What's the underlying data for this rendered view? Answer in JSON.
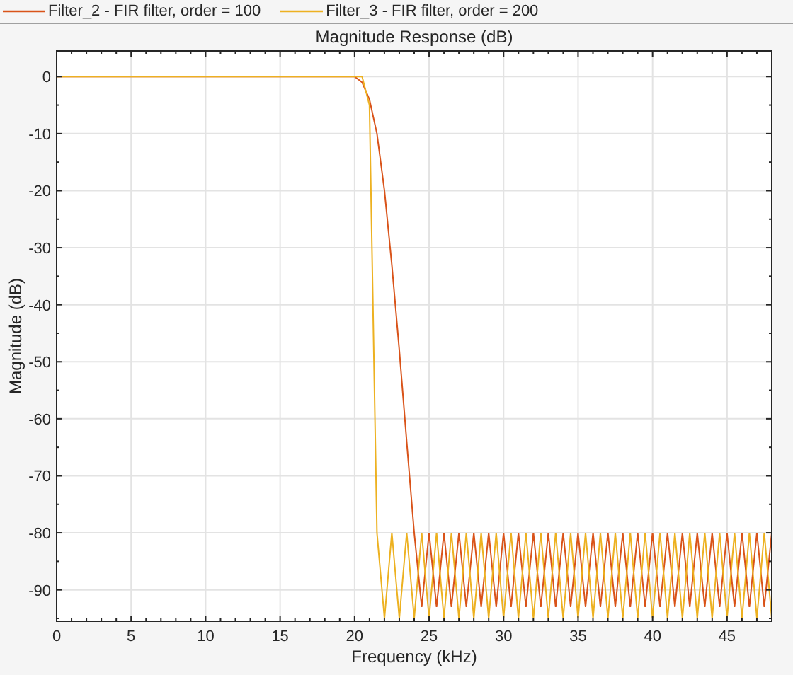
{
  "legend": {
    "kind": "legend"
  },
  "chart_data": {
    "type": "line",
    "title": "Magnitude Response (dB)",
    "xlabel": "Frequency (kHz)",
    "ylabel": "Magnitude (dB)",
    "x": [
      0,
      0.5,
      1,
      1.5,
      2,
      2.5,
      3,
      3.5,
      4,
      4.5,
      5,
      5.5,
      6,
      6.5,
      7,
      7.5,
      8,
      8.5,
      9,
      9.5,
      10,
      10.5,
      11,
      11.5,
      12,
      12.5,
      13,
      13.5,
      14,
      14.5,
      15,
      15.5,
      16,
      16.5,
      17,
      17.5,
      18,
      18.5,
      19,
      19.5,
      20,
      20.5,
      21,
      21.5,
      22,
      22.5,
      23,
      23.5,
      24,
      24.5,
      25,
      25.5,
      26,
      26.5,
      27,
      27.5,
      28,
      28.5,
      29,
      29.5,
      30,
      30.5,
      31,
      31.5,
      32,
      32.5,
      33,
      33.5,
      34,
      34.5,
      35,
      35.5,
      36,
      36.5,
      37,
      37.5,
      38,
      38.5,
      39,
      39.5,
      40,
      40.5,
      41,
      41.5,
      42,
      42.5,
      43,
      43.5,
      44,
      44.5,
      45,
      45.5,
      46,
      46.5,
      47,
      47.5,
      48
    ],
    "series": [
      {
        "name": "Filter_2 - FIR filter, order = 100",
        "color": "#d95319",
        "values": [
          0,
          0,
          0,
          0,
          0,
          0,
          0,
          0,
          0,
          0,
          0,
          0,
          0,
          0,
          0,
          0,
          0,
          0,
          0,
          0,
          0,
          0,
          0,
          0,
          0,
          0,
          0,
          0,
          0,
          0,
          0,
          0,
          0,
          0,
          0,
          0,
          0,
          0,
          0,
          0,
          0,
          -1,
          -4,
          -10,
          -20,
          -33,
          -48,
          -64,
          -80,
          -93,
          -80,
          -93,
          -80,
          -93,
          -80,
          -93,
          -80,
          -93,
          -80,
          -93,
          -80,
          -93,
          -80,
          -93,
          -80,
          -93,
          -80,
          -93,
          -80,
          -93,
          -80,
          -93,
          -80,
          -93,
          -80,
          -93,
          -80,
          -93,
          -80,
          -93,
          -80,
          -93,
          -80,
          -93,
          -80,
          -93,
          -80,
          -93,
          -80,
          -93,
          -80,
          -93,
          -80,
          -93,
          -80,
          -93,
          -80
        ]
      },
      {
        "name": "Filter_3 - FIR filter, order = 200",
        "color": "#edb120",
        "values": [
          0,
          0,
          0,
          0,
          0,
          0,
          0,
          0,
          0,
          0,
          0,
          0,
          0,
          0,
          0,
          0,
          0,
          0,
          0,
          0,
          0,
          0,
          0,
          0,
          0,
          0,
          0,
          0,
          0,
          0,
          0,
          0,
          0,
          0,
          0,
          0,
          0,
          0,
          0,
          0,
          0,
          0,
          -5,
          -80,
          -95,
          -80,
          -95,
          -80,
          -95,
          -80,
          -95,
          -80,
          -95,
          -80,
          -95,
          -80,
          -95,
          -80,
          -95,
          -80,
          -95,
          -80,
          -95,
          -80,
          -95,
          -80,
          -95,
          -80,
          -95,
          -80,
          -95,
          -80,
          -95,
          -80,
          -95,
          -80,
          -95,
          -80,
          -95,
          -80,
          -95,
          -80,
          -95,
          -80,
          -95,
          -80,
          -95,
          -80,
          -95,
          -80,
          -95,
          -80,
          -95,
          -80,
          -95,
          -80,
          -95
        ]
      }
    ],
    "grid": true,
    "xlim": [
      0,
      48
    ],
    "ylim": [
      -95.5,
      4.5
    ],
    "xticks": [
      0,
      5,
      10,
      15,
      20,
      25,
      30,
      35,
      40,
      45
    ],
    "yticks": [
      0,
      -10,
      -20,
      -30,
      -40,
      -50,
      -60,
      -70,
      -80,
      -90
    ]
  }
}
